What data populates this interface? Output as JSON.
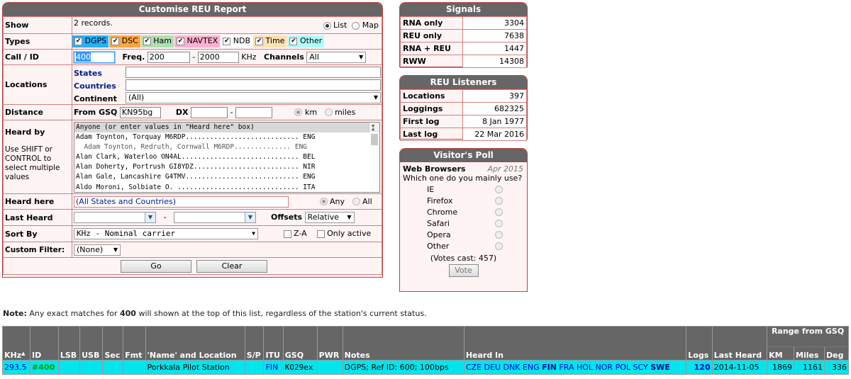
{
  "form": {
    "title": "Customise REU Report",
    "show": {
      "label": "Show",
      "records": "2 records.",
      "list": "List",
      "map": "Map"
    },
    "types": {
      "label": "Types",
      "items": [
        {
          "name": "DGPS",
          "bg": "#26b0ff"
        },
        {
          "name": "DSC",
          "bg": "#ffa640"
        },
        {
          "name": "Ham",
          "bg": "#b0e0b0"
        },
        {
          "name": "NAVTEX",
          "bg": "#ffb0d0"
        },
        {
          "name": "NDB",
          "bg": "#ffffff"
        },
        {
          "name": "Time",
          "bg": "#ffe0b0"
        },
        {
          "name": "Other",
          "bg": "#b0ffff"
        }
      ]
    },
    "call": {
      "label": "Call / ID",
      "value": "400",
      "freq_label": "Freq.",
      "freq_from": "200",
      "dash": "-",
      "freq_to": "2000",
      "khz": "KHz",
      "channels_label": "Channels",
      "channels_value": "All"
    },
    "locations": {
      "label": "Locations",
      "states": "States",
      "countries": "Countries",
      "continent": "Continent",
      "continent_value": "(All)"
    },
    "distance": {
      "label": "Distance",
      "gsq_label": "From GSQ",
      "gsq_value": "KN95bg",
      "dx_label": "DX",
      "dash": "-",
      "km": "km",
      "miles": "miles"
    },
    "heard_by": {
      "label": "Heard by",
      "help": "Use SHIFT or CONTROL to select multiple values",
      "options": [
        "Anyone (or enter values in \"Heard here\" box)",
        "Adam Toynton, Torquay M6RDP............................ ENG",
        "  Adam Toynton, Redruth, Cornwall M6RDP.............. ENG",
        "Alan Clark, Waterloo ON4AL............................. BEL",
        "Alan Doherty, Portrush GI8YDZ.......................... NIR",
        "Alan Gale, Lancashire G4TMV............................ ENG",
        "Aldo Moroni, Solbiate O. .............................. ITA"
      ]
    },
    "heard_here": {
      "label": "Heard here",
      "value": "(All States and Countries)",
      "any": "Any",
      "all": "All"
    },
    "last_heard": {
      "label": "Last Heard",
      "dash": "-",
      "offsets_label": "Offsets",
      "offsets_value": "Relative"
    },
    "sort": {
      "label": "Sort By",
      "value": "KHz - Nominal carrier",
      "za": "Z-A",
      "only_active": "Only active"
    },
    "custom": {
      "label": "Custom Filter:",
      "value": "(None)"
    },
    "go": "Go",
    "clear": "Clear"
  },
  "signals": {
    "title": "Signals",
    "rows": [
      {
        "k": "RNA only",
        "v": "3304"
      },
      {
        "k": "REU only",
        "v": "7638"
      },
      {
        "k": "RNA + REU",
        "v": "1447"
      },
      {
        "k": "RWW",
        "v": "14308"
      }
    ]
  },
  "listeners": {
    "title": "REU Listeners",
    "rows": [
      {
        "k": "Locations",
        "v": "397"
      },
      {
        "k": "Loggings",
        "v": "682325"
      },
      {
        "k": "First log",
        "v": "8 Jan 1977"
      },
      {
        "k": "Last log",
        "v": "22 Mar 2016"
      }
    ]
  },
  "poll": {
    "title": "Visitor's Poll",
    "heading": "Web Browsers",
    "date": "Apr 2015",
    "question": "Which one do you mainly use?",
    "options": [
      "IE",
      "Firefox",
      "Chrome",
      "Safari",
      "Opera",
      "Other"
    ],
    "votes": "(Votes cast: 457)",
    "vote": "Vote"
  },
  "note": {
    "bold": "Note:",
    "pre": " Any exact matches for ",
    "id": "400",
    "post": " will shown at the top of this list, regardless of the station's current status."
  },
  "table": {
    "range_header": "Range from GSQ",
    "headers": [
      "KHz",
      "ID",
      "LSB",
      "USB",
      "Sec",
      "Fmt",
      "'Name' and Location",
      "S/P",
      "ITU",
      "GSQ",
      "PWR",
      "Notes",
      "Heard In",
      "Logs",
      "Last Heard",
      "KM",
      "Miles",
      "Deg"
    ],
    "row": {
      "khz": "293.5",
      "id": "#400",
      "name": "Porkkala Pilot Station",
      "itu": "FIN",
      "gsq": "KO29ex",
      "notes": "DGPS; Ref ID: 600; 100bps",
      "heard_in": [
        "CZE",
        "DEU",
        "DNK",
        "ENG",
        "FIN",
        "FRA",
        "HOL",
        "NOR",
        "POL",
        "SCY",
        "SWE"
      ],
      "logs": "120",
      "last_heard": "2014-11-05",
      "km": "1869",
      "miles": "1161",
      "deg": "336"
    }
  }
}
